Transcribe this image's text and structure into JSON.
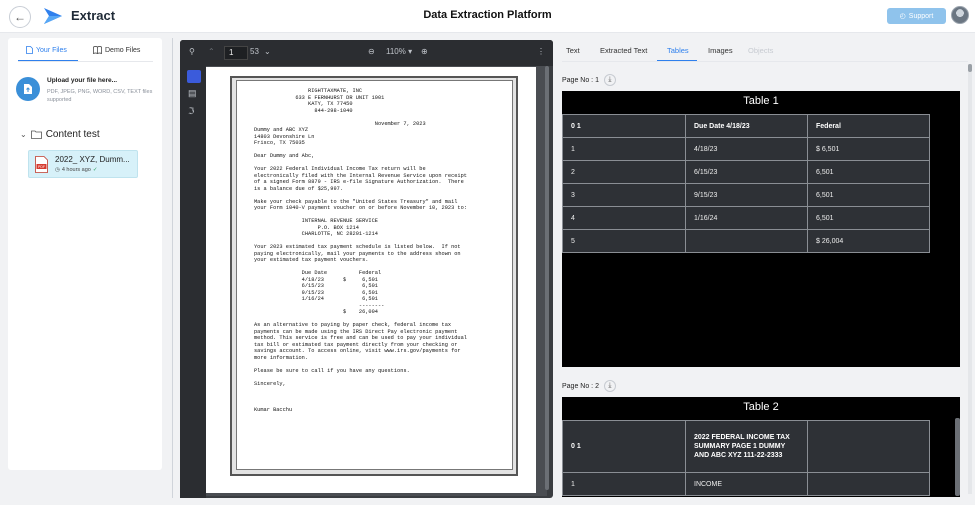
{
  "header": {
    "back_icon": "arrow-left-icon",
    "app_title": "Extract",
    "platform_title": "Data Extraction Platform",
    "support_label": "Support",
    "accent": "#8fc3ec"
  },
  "left": {
    "tabs": [
      {
        "label": "Your Files",
        "icon": "file-icon",
        "active": true
      },
      {
        "label": "Demo Files",
        "icon": "book-icon",
        "active": false
      }
    ],
    "upload_title": "Upload your file here...",
    "upload_sub": "PDF, JPEG, PNG, WORD, CSV, TEXT files supported",
    "folder_name": "Content test",
    "file": {
      "name": "2022_ XYZ, Dumm...",
      "time": "4 hours ago",
      "icon": "pdf-icon"
    }
  },
  "viewer": {
    "page": "1",
    "total_pages": "53",
    "zoom": "110%",
    "document_text": "                 RIGHTTAXMATE, INC\n             633 E FERNHURST DR UNIT 1001\n                 KATY, TX 77450\n                   844-298-1040\n\n                                      November 7, 2023\nDummy and ABC XYZ\n14803 Devonshire Ln\nFrisco, TX 75035\n\nDear Dummy and Abc,\n\nYour 2022 Federal Individual Income Tax return will be\nelectronically filed with the Internal Revenue Service upon receipt\nof a signed Form 8879 - IRS e-file Signature Authorization.  There\nis a balance due of $25,997.\n\nMake your check payable to the \"United States Treasury\" and mail\nyour Form 1040-V payment voucher on or before November 10, 2023 to:\n\n               INTERNAL REVENUE SERVICE\n                    P.O. BOX 1214\n               CHARLOTTE, NC 28201-1214\n\nYour 2023 estimated tax payment schedule is listed below.  If not\npaying electronically, mail your payments to the address shown on\nyour estimated tax payment vouchers.\n\n               Due Date          Federal\n               4/18/23      $     6,501\n               6/15/23            6,501\n               9/15/23            6,501\n               1/16/24            6,501\n                                 --------\n                            $    26,004\n\nAs an alternative to paying by paper check, federal income tax\npayments can be made using the IRS Direct Pay electronic payment\nmethod. This service is free and can be used to pay your individual\ntax bill or estimated tax payment directly from your checking or\nsavings account. To access online, visit www.irs.gov/payments for\nmore information.\n\nPlease be sure to call if you have any questions.\n\nSincerely,\n\n\n\nKumar Bacchu"
  },
  "right": {
    "tabs": [
      "Text",
      "Extracted Text",
      "Tables",
      "Images",
      "Objects"
    ],
    "active_tab": "Tables",
    "page1_label": "Page No : 1",
    "page2_label": "Page No : 2",
    "table1": {
      "title": "Table 1",
      "header": [
        "0 1",
        "Due Date 4/18/23",
        "Federal"
      ],
      "rows": [
        [
          "1",
          "4/18/23",
          "$ 6,501"
        ],
        [
          "2",
          "6/15/23",
          "6,501"
        ],
        [
          "3",
          "9/15/23",
          "6,501"
        ],
        [
          "4",
          "1/16/24",
          "6,501"
        ],
        [
          "5",
          "",
          "$ 26,004"
        ]
      ]
    },
    "table2": {
      "title": "Table 2",
      "header": [
        "0 1",
        "2022 FEDERAL INCOME TAX SUMMARY PAGE 1 DUMMY AND ABC XYZ 111-22-2333",
        ""
      ],
      "rows": [
        [
          "1",
          "INCOME",
          ""
        ]
      ]
    }
  }
}
